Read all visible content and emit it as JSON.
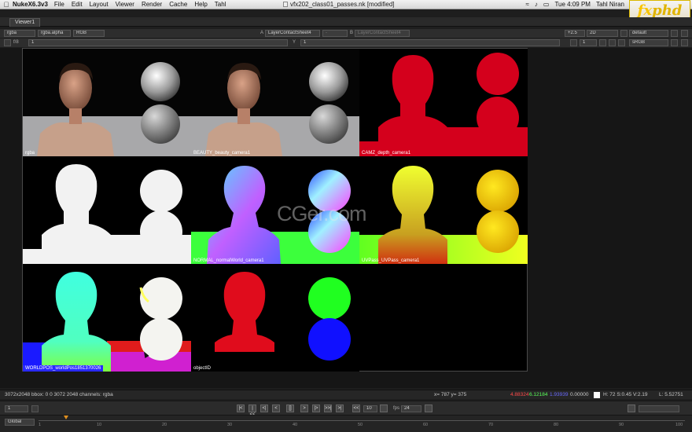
{
  "menubar": {
    "app": "NukeX6.3v3",
    "items": [
      "File",
      "Edit",
      "Layout",
      "Viewer",
      "Render",
      "Cache",
      "Help",
      "Tahl"
    ],
    "window_title": "vfx202_class01_passes.nk [modified]",
    "clock": "Tue 4:09 PM",
    "user": "Tahl Niran"
  },
  "logo": {
    "text_a": "fx",
    "text_b": "phd"
  },
  "viewer_tab": "Viewer1",
  "toolbar1": {
    "channels": "rgba",
    "alpha": "rgba.alpha",
    "colorspace": "RGB",
    "a_label": "A",
    "a_input": "LayerContactSheet4",
    "dash": "-",
    "b_label": "B",
    "b_input": "LayerContactSheet4",
    "gain": "+2.5",
    "view_mode": "2D",
    "lut": "default"
  },
  "toolbar2": {
    "fstop": "f/8",
    "gain_val": "1",
    "y_label": "Y",
    "gamma_val": "1",
    "proxy": "1",
    "display": "sRGB"
  },
  "cells": [
    {
      "caption": "rgba"
    },
    {
      "caption": "BEAUTY_beauty_camera1"
    },
    {
      "caption": "CAMZ_depth_camera1"
    },
    {
      "caption": ""
    },
    {
      "caption": "NORMAL_normalWorld_camera1"
    },
    {
      "caption": "UVPass_UVPass_camera1"
    },
    {
      "caption": "WORLDPOS_worldPos1851370026"
    },
    {
      "caption": "objectID"
    }
  ],
  "watermark": "CGer.com",
  "status": {
    "info": "3072x2048  bbox: 0 0 3072 2048  channels: rgba",
    "coords": "x= 787 y= 375",
    "r": "4.88324",
    "g": "6.12184",
    "b": "1.93939",
    "a": "0.00000",
    "hsv": "H: 72 S:0.45 V:2.19",
    "lum": "L: 5.52751",
    "colors": {
      "r": "#ff4a4a",
      "g": "#5aff5a",
      "b": "#6a6aff"
    }
  },
  "transport": {
    "frame": "1",
    "increment": "10",
    "fps_label": "fps",
    "fps": "24",
    "buttons": [
      "|<",
      "|<<",
      "<|",
      "<",
      "[]",
      ">",
      "|>",
      ">>|",
      ">|",
      "<<"
    ],
    "scope": "Global"
  },
  "timeline": {
    "ticks": [
      "1",
      "10",
      "20",
      "30",
      "40",
      "50",
      "60",
      "70",
      "80",
      "90",
      "100"
    ],
    "end": "100"
  }
}
